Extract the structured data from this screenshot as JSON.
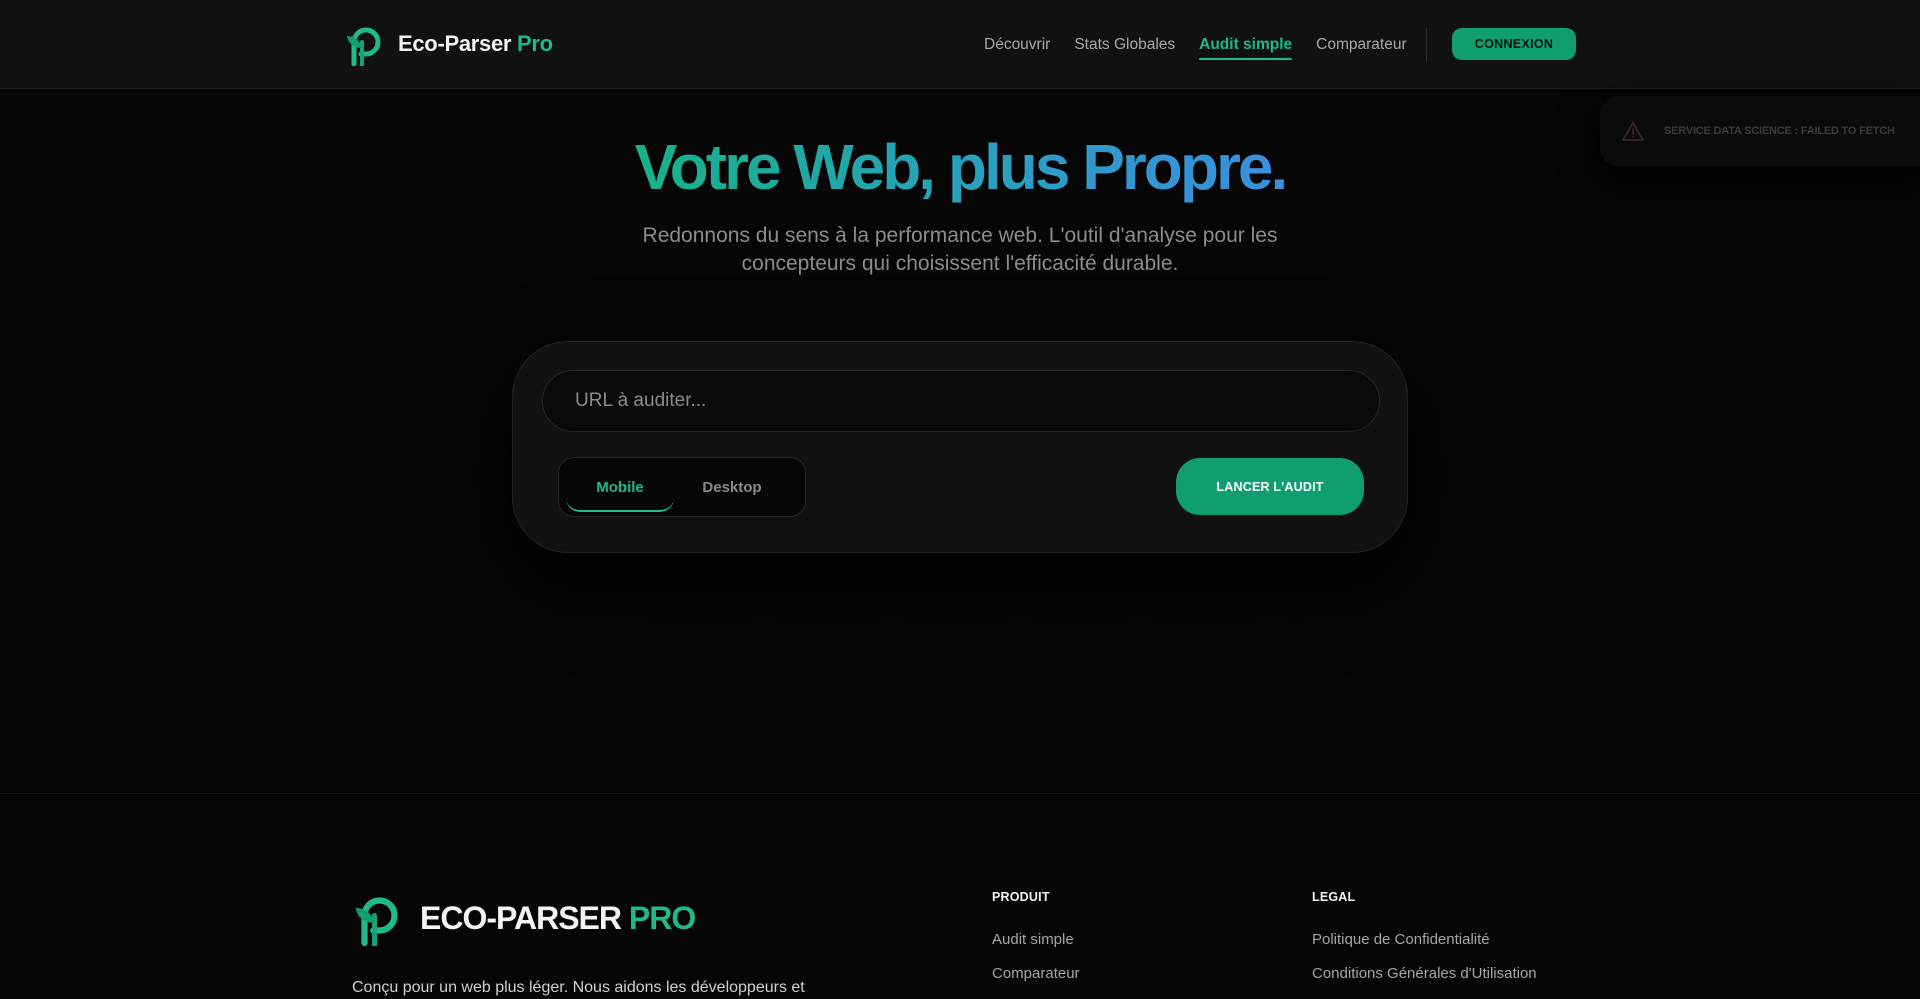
{
  "header": {
    "brand_main": "Eco-Parser",
    "brand_accent": "Pro",
    "nav": [
      {
        "label": "Découvrir",
        "active": false
      },
      {
        "label": "Stats Globales",
        "active": false
      },
      {
        "label": "Audit simple",
        "active": true
      },
      {
        "label": "Comparateur",
        "active": false
      }
    ],
    "login_label": "CONNEXION"
  },
  "toast": {
    "icon": "warning-triangle-icon",
    "message": "SERVICE DATA SCIENCE : FAILED TO FETCH"
  },
  "hero": {
    "title": "Votre Web, plus Propre.",
    "subtitle": "Redonnons du sens à la performance web. L'outil d'analyse pour les concepteurs qui choisissent l'efficacité durable."
  },
  "audit": {
    "url_placeholder": "URL à auditer...",
    "url_value": "",
    "devices": [
      {
        "label": "Mobile",
        "active": true
      },
      {
        "label": "Desktop",
        "active": false
      }
    ],
    "launch_label": "LANCER L'AUDIT"
  },
  "footer": {
    "brand_main": "ECO-PARSER",
    "brand_accent": "PRO",
    "description": "Conçu pour un web plus léger. Nous aidons les développeurs et",
    "columns": [
      {
        "title": "PRODUIT",
        "links": [
          "Audit simple",
          "Comparateur"
        ]
      },
      {
        "title": "LEGAL",
        "links": [
          "Politique de Confidentialité",
          "Conditions Générales d'Utilisation"
        ]
      }
    ]
  },
  "colors": {
    "accent": "#1fb98a",
    "button": "#0e9e6f",
    "background": "#060606",
    "header_bg": "#111114",
    "gradient_end": "#3b8ee0"
  }
}
